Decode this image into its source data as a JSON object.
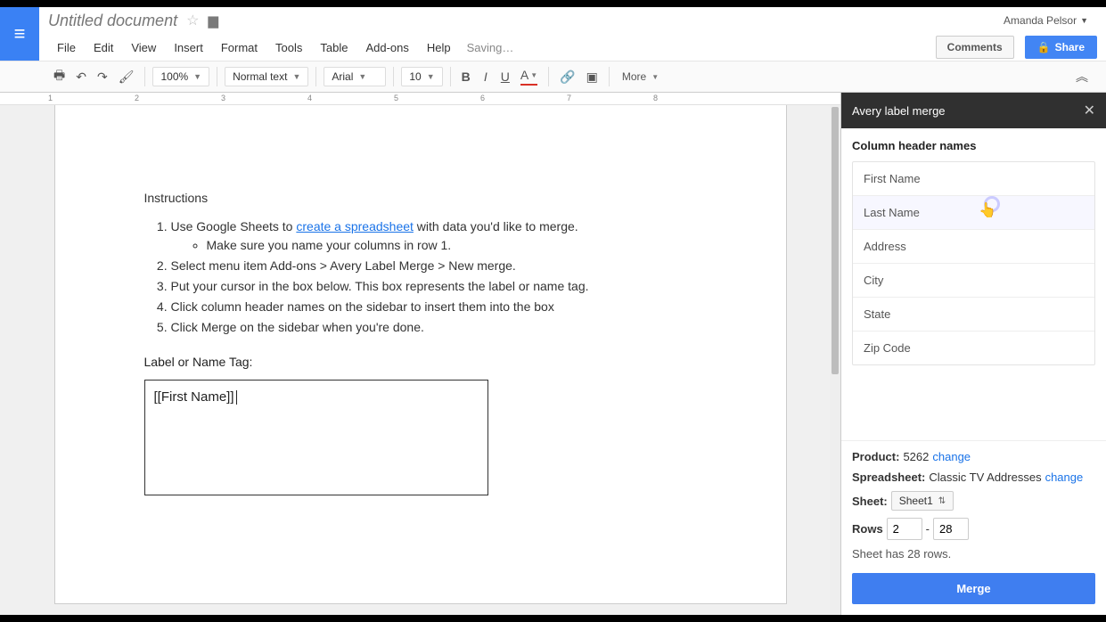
{
  "header": {
    "doc_title": "Untitled document",
    "user_name": "Amanda Pelsor",
    "comments_btn": "Comments",
    "share_btn": "Share",
    "saving": "Saving…"
  },
  "menus": [
    "File",
    "Edit",
    "View",
    "Insert",
    "Format",
    "Tools",
    "Table",
    "Add-ons",
    "Help"
  ],
  "toolbar": {
    "zoom": "100%",
    "style": "Normal text",
    "font": "Arial",
    "size": "10",
    "more": "More"
  },
  "ruler": [
    "1",
    "2",
    "3",
    "4",
    "5",
    "6",
    "7",
    "8"
  ],
  "document": {
    "instructions_heading": "Instructions",
    "step1_pre": "Use Google Sheets to ",
    "step1_link": "create a spreadsheet",
    "step1_post": " with data you'd like to merge.",
    "step1_sub": "Make sure you name your columns in row 1.",
    "step2": "Select menu item Add-ons > Avery Label Merge > New merge.",
    "step3": "Put your cursor in the box below. This box represents the label or name tag.",
    "step4": "Click column header names on the sidebar to insert them into the box",
    "step5": "Click Merge on the sidebar when you're done.",
    "label_heading": "Label or Name Tag:",
    "label_content": "[[First Name]]"
  },
  "sidebar": {
    "title": "Avery label merge",
    "section_title": "Column header names",
    "columns": [
      "First Name",
      "Last Name",
      "Address",
      "City",
      "State",
      "Zip Code"
    ],
    "product_label": "Product:",
    "product_value": "5262",
    "change": "change",
    "spreadsheet_label": "Spreadsheet:",
    "spreadsheet_value": "Classic TV Addresses",
    "sheet_label": "Sheet:",
    "sheet_value": "Sheet1",
    "rows_label": "Rows",
    "rows_from": "2",
    "rows_to": "28",
    "rows_dash": "-",
    "rows_note": "Sheet has 28 rows.",
    "merge_btn": "Merge"
  }
}
